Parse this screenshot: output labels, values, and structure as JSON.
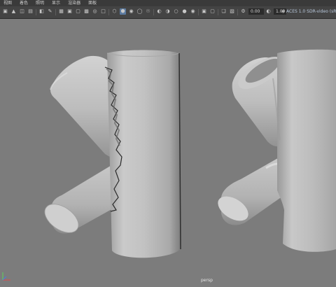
{
  "menubar": {
    "items": [
      "视图",
      "着色",
      "照明",
      "显示",
      "渲染器",
      "面板"
    ]
  },
  "toolbar": {
    "exposure_value": "0.00",
    "gamma_value": "1.00",
    "color_space": "ACES 1.0 SDR-video (sRGB"
  },
  "viewport": {
    "camera_label": "persp",
    "background_color": "#7c7c7c"
  },
  "icons": [
    "camera-icon",
    "grid-icon",
    "wireframe-icon",
    "smooth-shade-icon",
    "textured-icon",
    "lights-icon",
    "shadows-icon",
    "isolate-icon",
    "xray-icon",
    "exposure-icon",
    "gamma-icon"
  ]
}
